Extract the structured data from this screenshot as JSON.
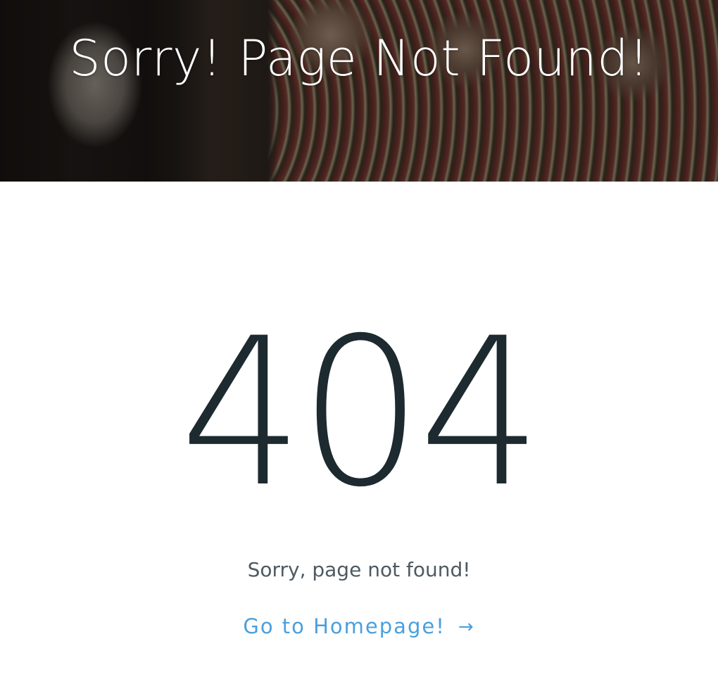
{
  "hero": {
    "title": "Sorry! Page Not Found!"
  },
  "error": {
    "code": "404",
    "message": "Sorry, page not found!"
  },
  "home_link": {
    "label": "Go to Homepage!",
    "arrow": "→",
    "icon": "arrow-right-icon"
  },
  "colors": {
    "code": "#1d2a30",
    "message": "#4d5a62",
    "link": "#4a9fdc",
    "hero_title": "#ffffff"
  }
}
